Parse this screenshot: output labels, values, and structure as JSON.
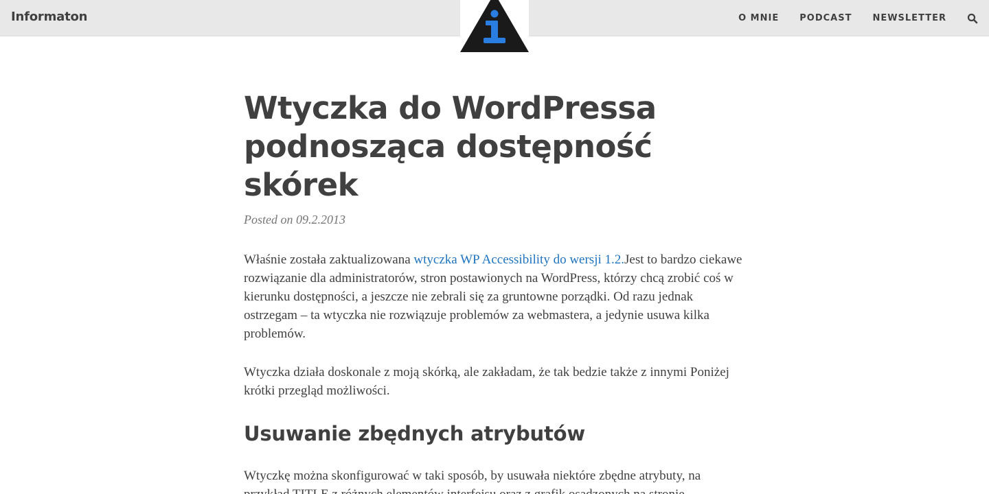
{
  "header": {
    "site_title": "Informaton",
    "nav": {
      "about": "O MNIE",
      "podcast": "PODCAST",
      "newsletter": "NEWSLETTER"
    },
    "search_icon": "search-icon",
    "logo": {
      "icon": "info-triangle-logo",
      "triangle_color": "#1a1a1a",
      "glyph_color": "#2a7de1"
    }
  },
  "post": {
    "title": "Wtyczka do WordPressa podnosząca dostępność skórek",
    "meta_prefix": "Posted on",
    "date": "09.2.2013",
    "p1_before": "Właśnie została zaktualizowana ",
    "p1_link": "wtyczka WP Accessibility do wersji 1.2.",
    "p1_after": "Jest to bardzo ciekawe rozwiązanie dla administratorów, stron postawionych na WordPress, którzy chcą zrobić coś w kierunku dostępności, a jeszcze nie zebrali się za gruntowne porządki. Od razu jednak ostrzegam – ta wtyczka nie rozwiązuje problemów za webmastera, a jedynie usuwa kilka problemów.",
    "p2": "Wtyczka działa doskonale z moją skórką, ale zakładam, że tak bedzie także z innymi Poniżej krótki przegląd możliwości.",
    "h2": "Usuwanie zbędnych atrybutów",
    "p3": "Wtyczkę można skonfigurować w taki sposób, by usuwała niektóre zbędne atrybuty, na przykład TITLE z różnych elementów interfejsu oraz z grafik osadzonych na stronie."
  },
  "colors": {
    "topbar_bg": "#e8e8e8",
    "text": "#404040",
    "meta": "#767676",
    "link": "#1e73be"
  }
}
